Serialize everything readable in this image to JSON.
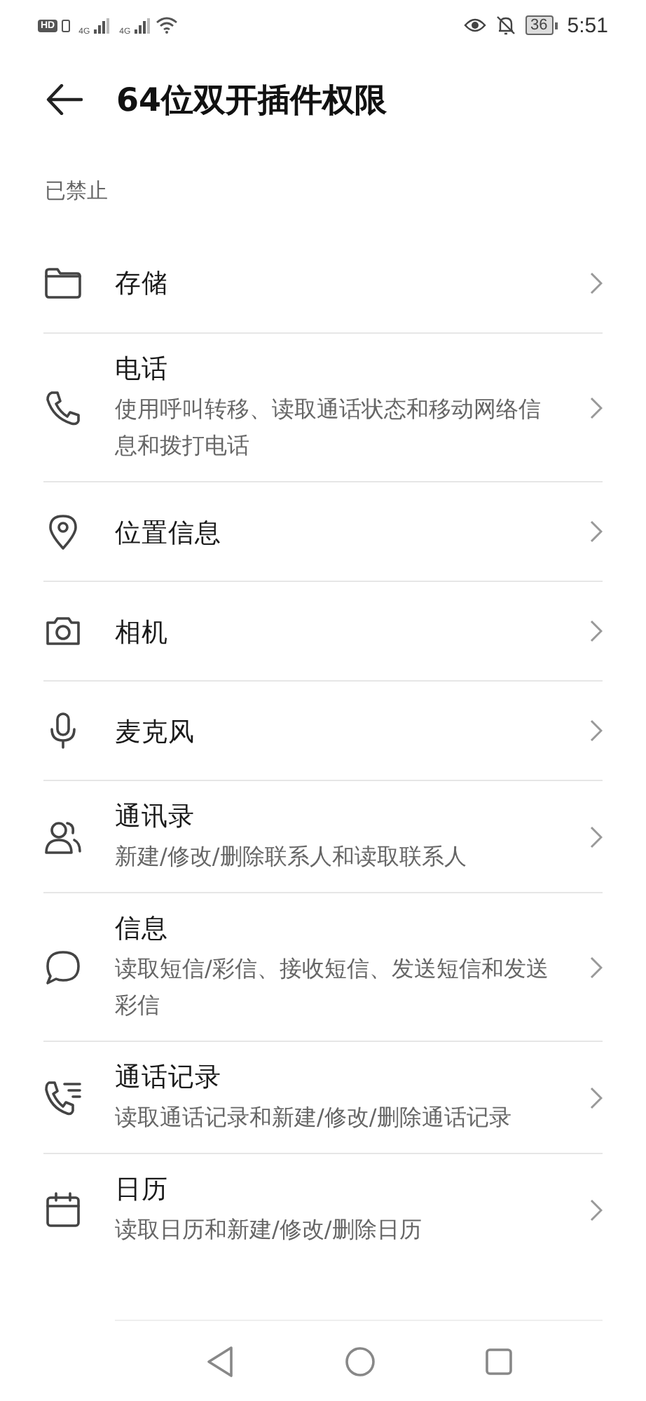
{
  "status_bar": {
    "left": [
      "HD",
      "4G",
      "4G"
    ],
    "battery": "36",
    "time": "5:51"
  },
  "header": {
    "title": "64位双开插件权限"
  },
  "section": {
    "title": "已禁止"
  },
  "permissions": [
    {
      "title": "存储"
    },
    {
      "title": "电话",
      "description": "使用呼叫转移、读取通话状态和移动网络信息和拨打电话"
    },
    {
      "title": "位置信息"
    },
    {
      "title": "相机"
    },
    {
      "title": "麦克风"
    },
    {
      "title": "通讯录",
      "description": "新建/修改/删除联系人和读取联系人"
    },
    {
      "title": "信息",
      "description": "读取短信/彩信、接收短信、发送短信和发送彩信"
    },
    {
      "title": "通话记录",
      "description": "读取通话记录和新建/修改/删除通话记录"
    },
    {
      "title": "日历",
      "description": "读取日历和新建/修改/删除日历"
    }
  ]
}
